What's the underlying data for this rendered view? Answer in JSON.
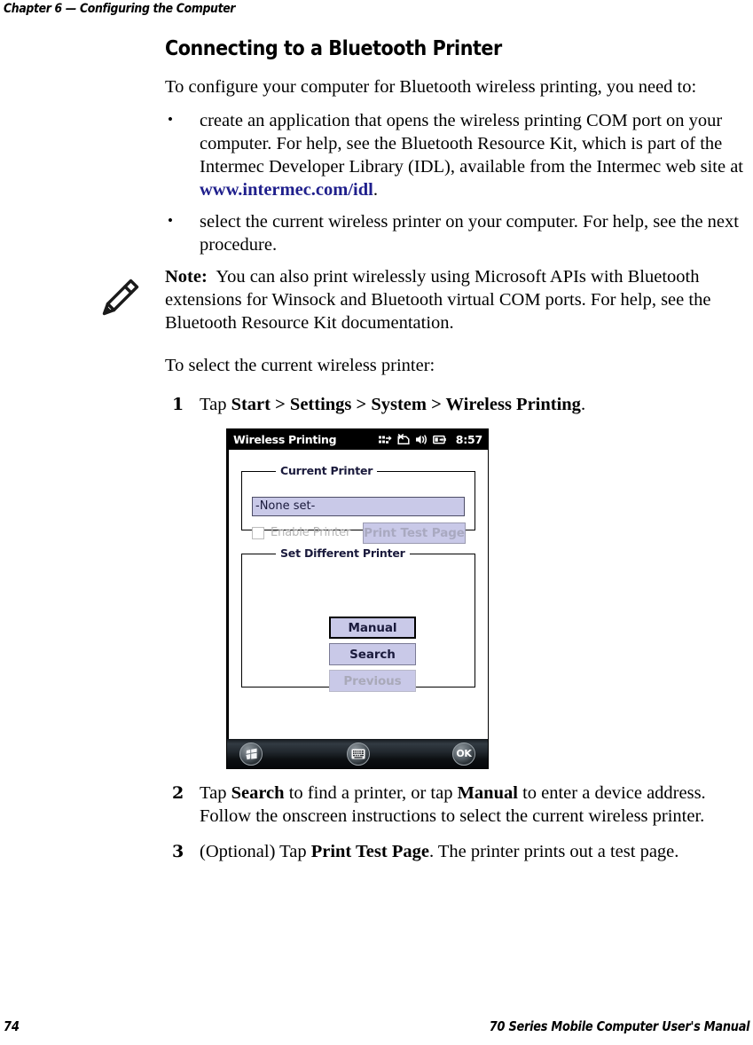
{
  "page": {
    "running_head": "Chapter 6 — Configuring the Computer",
    "page_number": "74",
    "footer_title": "70 Series Mobile Computer User's Manual"
  },
  "section": {
    "title": "Connecting to a Bluetooth Printer",
    "intro": "To configure your computer for Bluetooth wireless printing, you need to:"
  },
  "bullets": [
    {
      "text_before_link": "create an application that opens the wireless printing COM port on your computer. For help, see the Bluetooth Resource Kit, which is part of the Intermec Developer Library (IDL), available from the Intermec web site at ",
      "link": "www.intermec.com/idl",
      "text_after_link": "."
    },
    {
      "text_before_link": "select the current wireless printer on your computer. For help, see the next procedure.",
      "link": "",
      "text_after_link": ""
    }
  ],
  "note": {
    "icon": "pencil-icon",
    "label": "Note:",
    "body": "You can also print wirelessly using Microsoft APIs with Bluetooth extensions for Winsock and Bluetooth virtual COM ports. For help, see the Bluetooth Resource Kit documentation."
  },
  "procedure": {
    "lead_in": "To select the current wireless printer:",
    "steps": [
      {
        "number": "1",
        "parts": [
          {
            "text": "Tap ",
            "bold": false
          },
          {
            "text": "Start > Settings > System  > Wireless Printing",
            "bold": true
          },
          {
            "text": ".",
            "bold": false
          }
        ]
      },
      {
        "number": "2",
        "parts": [
          {
            "text": "Tap ",
            "bold": false
          },
          {
            "text": "Search",
            "bold": true
          },
          {
            "text": " to find a printer, or tap ",
            "bold": false
          },
          {
            "text": "Manual",
            "bold": true
          },
          {
            "text": " to enter a device address. Follow the onscreen instructions to select the current wireless printer.",
            "bold": false
          }
        ]
      },
      {
        "number": "3",
        "parts": [
          {
            "text": "(Optional) Tap ",
            "bold": false
          },
          {
            "text": "Print Test Page",
            "bold": true
          },
          {
            "text": ". The printer prints out a test page.",
            "bold": false
          }
        ]
      }
    ]
  },
  "device_screenshot": {
    "titlebar": {
      "title": "Wireless Printing",
      "clock": "8:57",
      "icons": [
        "connectivity-icon",
        "network-disconnected-icon",
        "volume-icon",
        "battery-power-icon"
      ]
    },
    "current_printer_group": {
      "legend": "Current Printer",
      "printer_value": "-None set-",
      "enable_printer_label": "Enable Printer",
      "enable_printer_checked": false,
      "enable_printer_enabled": false,
      "print_test_page_label": "Print Test Page",
      "print_test_page_enabled": false
    },
    "set_different_printer_group": {
      "legend": "Set Different Printer",
      "buttons": [
        {
          "label": "Manual",
          "state": "default-focused"
        },
        {
          "label": "Search",
          "state": "normal"
        },
        {
          "label": "Previous",
          "state": "disabled"
        }
      ]
    },
    "taskbar": {
      "start_icon": "windows-start-icon",
      "keyboard_icon": "keyboard-icon",
      "ok_label": "OK"
    },
    "colors": {
      "control_fill": "#c9c9e8",
      "control_text": "#1a1a3c",
      "disabled_text": "#a9a9c0",
      "titlebar_bg": "#000000"
    }
  }
}
